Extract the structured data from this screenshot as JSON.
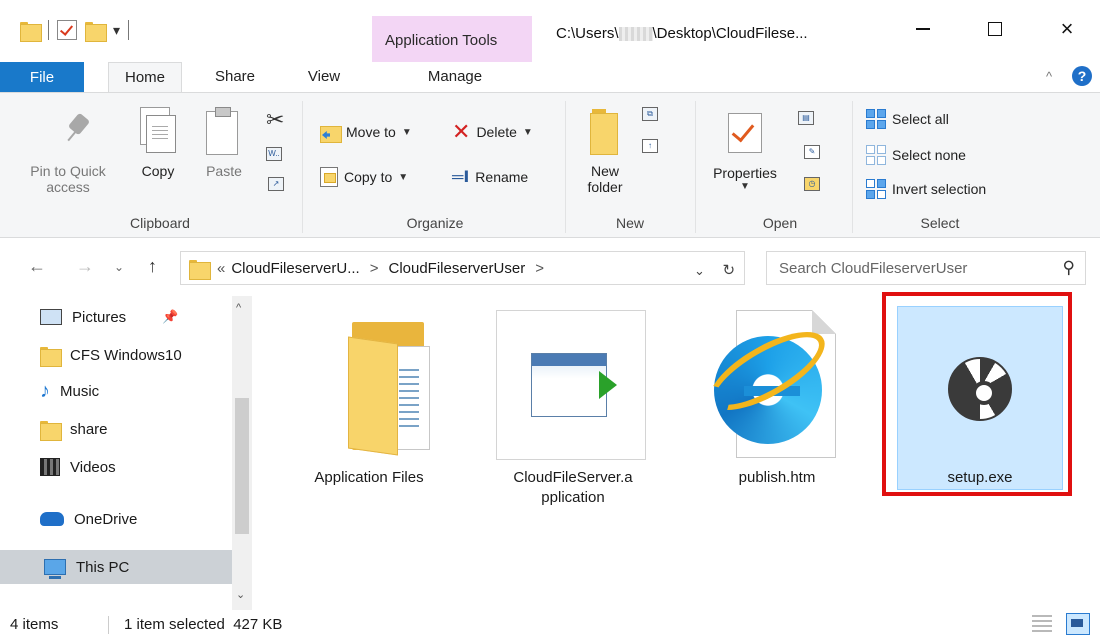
{
  "window": {
    "contextual_tab": "Application Tools",
    "title_prefix": "C:\\Users\\",
    "title_suffix": "\\Desktop\\CloudFilese...",
    "minimize": "—",
    "maximize": "☐",
    "close": "×"
  },
  "tabs": {
    "file": "File",
    "home": "Home",
    "share": "Share",
    "view": "View",
    "manage": "Manage"
  },
  "ribbon": {
    "clipboard": {
      "pin_label_1": "Pin to Quick",
      "pin_label_2": "access",
      "copy": "Copy",
      "paste": "Paste",
      "group": "Clipboard"
    },
    "organize": {
      "move_to": "Move to",
      "copy_to": "Copy to",
      "delete": "Delete",
      "rename": "Rename",
      "group": "Organize"
    },
    "new": {
      "new_folder_1": "New",
      "new_folder_2": "folder",
      "group": "New"
    },
    "open": {
      "properties": "Properties",
      "group": "Open"
    },
    "select": {
      "select_all": "Select all",
      "select_none": "Select none",
      "invert_selection": "Invert selection",
      "group": "Select"
    }
  },
  "address": {
    "overflow": "«",
    "crumb1": "CloudFileserverU...",
    "crumb2": "CloudFileserverUser",
    "sep": ">",
    "search_placeholder": "Search CloudFileserverUser"
  },
  "nav_pane": {
    "items": [
      {
        "label": "Pictures",
        "icon": "pictures-icon"
      },
      {
        "label": "CFS Windows10",
        "icon": "folder-icon"
      },
      {
        "label": "Music",
        "icon": "music-icon"
      },
      {
        "label": "share",
        "icon": "folder-icon"
      },
      {
        "label": "Videos",
        "icon": "videos-icon"
      },
      {
        "label": "OneDrive",
        "icon": "onedrive-icon"
      },
      {
        "label": "This PC",
        "icon": "this-pc-icon"
      }
    ]
  },
  "files": [
    {
      "name": "Application Files",
      "type": "folder"
    },
    {
      "name_line1": "CloudFileServer.a",
      "name_line2": "pplication",
      "type": "application"
    },
    {
      "name": "publish.htm",
      "type": "htm"
    },
    {
      "name": "setup.exe",
      "type": "exe",
      "selected": true,
      "highlight_color": "#e01010"
    }
  ],
  "status": {
    "items": "4 items",
    "selection": "1 item selected  427 KB"
  },
  "colors": {
    "file_tab": "#1979ca",
    "contextual": "#f3d6f5",
    "selection": "#cce8ff",
    "highlight": "#e01010"
  }
}
